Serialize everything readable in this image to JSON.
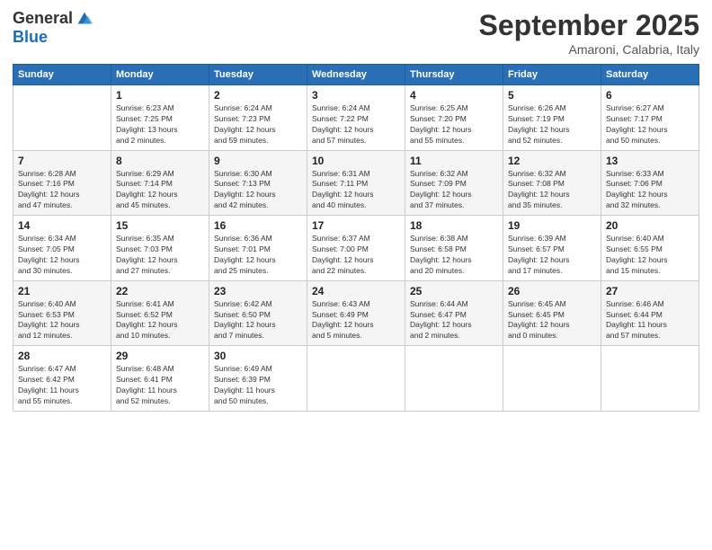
{
  "logo": {
    "text_general": "General",
    "text_blue": "Blue"
  },
  "header": {
    "month": "September 2025",
    "location": "Amaroni, Calabria, Italy"
  },
  "weekdays": [
    "Sunday",
    "Monday",
    "Tuesday",
    "Wednesday",
    "Thursday",
    "Friday",
    "Saturday"
  ],
  "weeks": [
    [
      {
        "day": "",
        "info": ""
      },
      {
        "day": "1",
        "info": "Sunrise: 6:23 AM\nSunset: 7:25 PM\nDaylight: 13 hours\nand 2 minutes."
      },
      {
        "day": "2",
        "info": "Sunrise: 6:24 AM\nSunset: 7:23 PM\nDaylight: 12 hours\nand 59 minutes."
      },
      {
        "day": "3",
        "info": "Sunrise: 6:24 AM\nSunset: 7:22 PM\nDaylight: 12 hours\nand 57 minutes."
      },
      {
        "day": "4",
        "info": "Sunrise: 6:25 AM\nSunset: 7:20 PM\nDaylight: 12 hours\nand 55 minutes."
      },
      {
        "day": "5",
        "info": "Sunrise: 6:26 AM\nSunset: 7:19 PM\nDaylight: 12 hours\nand 52 minutes."
      },
      {
        "day": "6",
        "info": "Sunrise: 6:27 AM\nSunset: 7:17 PM\nDaylight: 12 hours\nand 50 minutes."
      }
    ],
    [
      {
        "day": "7",
        "info": "Sunrise: 6:28 AM\nSunset: 7:16 PM\nDaylight: 12 hours\nand 47 minutes."
      },
      {
        "day": "8",
        "info": "Sunrise: 6:29 AM\nSunset: 7:14 PM\nDaylight: 12 hours\nand 45 minutes."
      },
      {
        "day": "9",
        "info": "Sunrise: 6:30 AM\nSunset: 7:13 PM\nDaylight: 12 hours\nand 42 minutes."
      },
      {
        "day": "10",
        "info": "Sunrise: 6:31 AM\nSunset: 7:11 PM\nDaylight: 12 hours\nand 40 minutes."
      },
      {
        "day": "11",
        "info": "Sunrise: 6:32 AM\nSunset: 7:09 PM\nDaylight: 12 hours\nand 37 minutes."
      },
      {
        "day": "12",
        "info": "Sunrise: 6:32 AM\nSunset: 7:08 PM\nDaylight: 12 hours\nand 35 minutes."
      },
      {
        "day": "13",
        "info": "Sunrise: 6:33 AM\nSunset: 7:06 PM\nDaylight: 12 hours\nand 32 minutes."
      }
    ],
    [
      {
        "day": "14",
        "info": "Sunrise: 6:34 AM\nSunset: 7:05 PM\nDaylight: 12 hours\nand 30 minutes."
      },
      {
        "day": "15",
        "info": "Sunrise: 6:35 AM\nSunset: 7:03 PM\nDaylight: 12 hours\nand 27 minutes."
      },
      {
        "day": "16",
        "info": "Sunrise: 6:36 AM\nSunset: 7:01 PM\nDaylight: 12 hours\nand 25 minutes."
      },
      {
        "day": "17",
        "info": "Sunrise: 6:37 AM\nSunset: 7:00 PM\nDaylight: 12 hours\nand 22 minutes."
      },
      {
        "day": "18",
        "info": "Sunrise: 6:38 AM\nSunset: 6:58 PM\nDaylight: 12 hours\nand 20 minutes."
      },
      {
        "day": "19",
        "info": "Sunrise: 6:39 AM\nSunset: 6:57 PM\nDaylight: 12 hours\nand 17 minutes."
      },
      {
        "day": "20",
        "info": "Sunrise: 6:40 AM\nSunset: 6:55 PM\nDaylight: 12 hours\nand 15 minutes."
      }
    ],
    [
      {
        "day": "21",
        "info": "Sunrise: 6:40 AM\nSunset: 6:53 PM\nDaylight: 12 hours\nand 12 minutes."
      },
      {
        "day": "22",
        "info": "Sunrise: 6:41 AM\nSunset: 6:52 PM\nDaylight: 12 hours\nand 10 minutes."
      },
      {
        "day": "23",
        "info": "Sunrise: 6:42 AM\nSunset: 6:50 PM\nDaylight: 12 hours\nand 7 minutes."
      },
      {
        "day": "24",
        "info": "Sunrise: 6:43 AM\nSunset: 6:49 PM\nDaylight: 12 hours\nand 5 minutes."
      },
      {
        "day": "25",
        "info": "Sunrise: 6:44 AM\nSunset: 6:47 PM\nDaylight: 12 hours\nand 2 minutes."
      },
      {
        "day": "26",
        "info": "Sunrise: 6:45 AM\nSunset: 6:45 PM\nDaylight: 12 hours\nand 0 minutes."
      },
      {
        "day": "27",
        "info": "Sunrise: 6:46 AM\nSunset: 6:44 PM\nDaylight: 11 hours\nand 57 minutes."
      }
    ],
    [
      {
        "day": "28",
        "info": "Sunrise: 6:47 AM\nSunset: 6:42 PM\nDaylight: 11 hours\nand 55 minutes."
      },
      {
        "day": "29",
        "info": "Sunrise: 6:48 AM\nSunset: 6:41 PM\nDaylight: 11 hours\nand 52 minutes."
      },
      {
        "day": "30",
        "info": "Sunrise: 6:49 AM\nSunset: 6:39 PM\nDaylight: 11 hours\nand 50 minutes."
      },
      {
        "day": "",
        "info": ""
      },
      {
        "day": "",
        "info": ""
      },
      {
        "day": "",
        "info": ""
      },
      {
        "day": "",
        "info": ""
      }
    ]
  ]
}
